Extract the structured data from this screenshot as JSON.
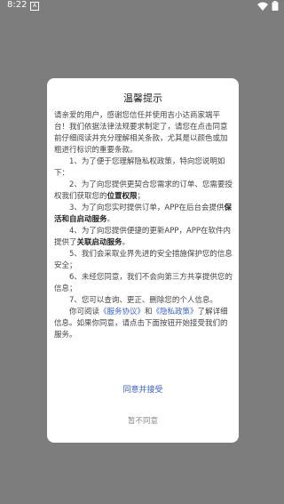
{
  "status_bar": {
    "time": "8:22",
    "app_icon": "android-notification-icon",
    "wifi_icon": "wifi-icon",
    "battery_icon": "battery-icon"
  },
  "dialog": {
    "title": "温馨提示",
    "intro": "请亲爱的用户，感谢您信任并使用吉小达商家端平台！我们依据法律法规要求制定了，请您在点击同意前仔细阅读并充分理解相关条款，尤其是以颜色或加粗进行标识的重要条款。",
    "items": {
      "i1": "1、为了便于您理解隐私权政策，特向您说明如下：",
      "i2a": "2、为了向您提供更契合您需求的订单、您需要授权我们获取您的",
      "i2b": "位置权限",
      "i2c": "；",
      "i3a": "3、为了向您实时提供订单，APP在后台会提供",
      "i3b": "保活和自启动服务",
      "i3c": "。",
      "i4a": "4、为了向您提供便捷的更新APP，APP在软件内提供了",
      "i4b": "关联启动服务",
      "i4c": "。",
      "i5": "5、我们会采取业界先进的安全措施保护您的信息安全；",
      "i6": "6、未经您同意，我们不会向第三方共享提供您的信息；",
      "i7": "7、您可以查询、更正、删除您的个人信息。"
    },
    "outro": {
      "prefix": "你可阅读",
      "service_link": "《服务协议》",
      "and": "和",
      "privacy_link": "《隐私政策》",
      "suffix": "了解详细信息。如果你同意，请点击下面按钮开始接受我们的服务。"
    },
    "agree_label": "同意并接受",
    "disagree_label": "暂不同意"
  },
  "colors": {
    "overlay": "#7d7d7d",
    "link": "#3a62d6",
    "muted": "#888888"
  }
}
